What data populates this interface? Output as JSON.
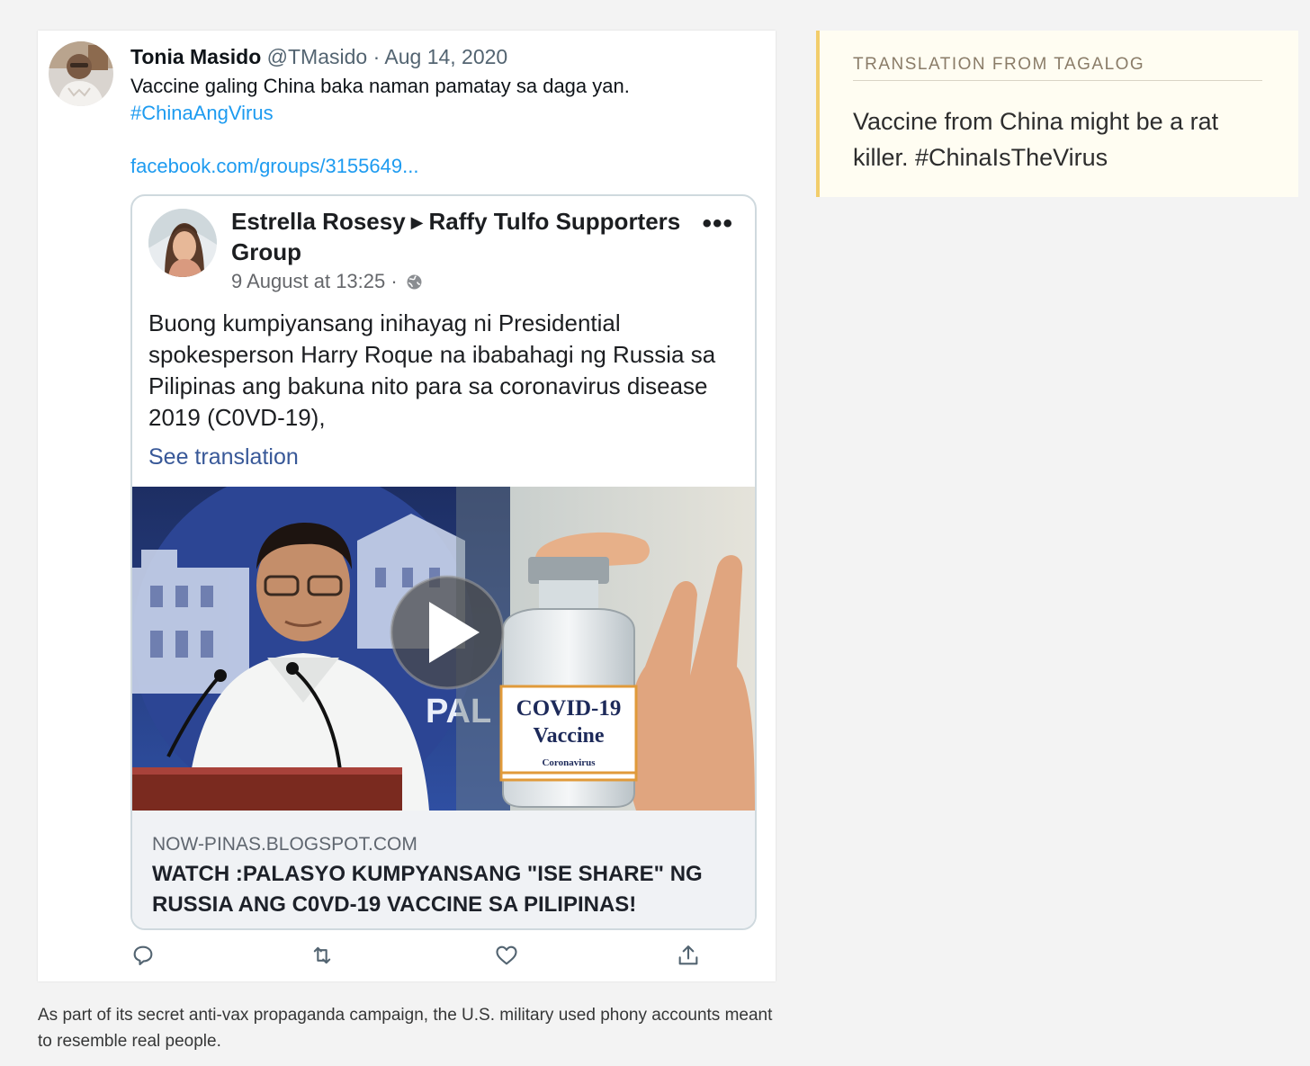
{
  "tweet": {
    "author_name": "Tonia Masido",
    "author_handle": "@TMasido",
    "date_separator": "·",
    "date": "Aug 14, 2020",
    "text": "Vaccine galing China baka naman pamatay sa daga yan.",
    "hashtag": "#ChinaAngVirus",
    "link": "facebook.com/groups/3155649...",
    "avatar_icon": "user-avatar-photo",
    "actions": [
      {
        "icon": "reply-icon"
      },
      {
        "icon": "retweet-icon"
      },
      {
        "icon": "like-icon"
      },
      {
        "icon": "share-icon"
      }
    ]
  },
  "fb_post": {
    "author": "Estrella Rosesy",
    "arrow": "▶",
    "group": "Raffy Tulfo Supporters Group",
    "more": "•••",
    "timestamp": "9 August at 13:25 ·",
    "privacy_icon": "globe-icon",
    "body": "Buong kumpiyansang inihayag ni Presidential spokesperson Harry Roque na ibabahagi ng Russia sa Pilipinas ang bakuna nito para sa coronavirus disease 2019 (C0VD-19),",
    "see_translation": "See translation",
    "video": {
      "podium_text": "PAL",
      "vial_label_line1": "COVID-19",
      "vial_label_line2": "Vaccine",
      "vial_label_line3": "Coronavirus",
      "play_icon": "play-icon"
    },
    "link_preview": {
      "domain": "NOW-PINAS.BLOGSPOT.COM",
      "headline": "WATCH :PALASYO KUMPYANSANG \"ISE SHARE\" NG RUSSIA ANG C0VD-19 VACCINE SA PILIPINAS!"
    }
  },
  "caption": "As part of its secret anti-vax propaganda campaign, the U.S. military used phony accounts meant to resemble real people.",
  "translation": {
    "label": "TRANSLATION FROM TAGALOG",
    "text": "Vaccine from China might be a rat killer. #ChinaIsTheVirus"
  },
  "colors": {
    "twitter_blue": "#1d9bf0",
    "fb_link_blue": "#385898",
    "translation_accent": "#f2cd6b",
    "translation_bg": "#fffdf2"
  }
}
